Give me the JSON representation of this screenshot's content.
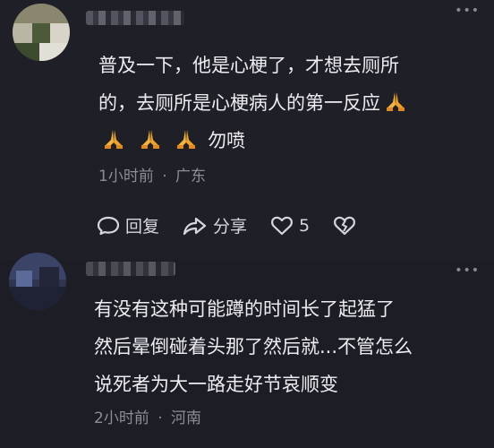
{
  "comments": [
    {
      "text_line1": "普及一下，他是心梗了，才想去厕所",
      "text_line2": "的，去厕所是心梗病人的第一反应",
      "text_line3_suffix": "勿喷",
      "time": "1小时前",
      "location": "广东",
      "actions": {
        "reply_label": "回复",
        "share_label": "分享",
        "like_count": "5"
      }
    },
    {
      "text_line1": "有没有这种可能蹲的时间长了起猛了",
      "text_line2": "然后晕倒碰着头那了然后就...不管怎么",
      "text_line3": "说死者为大一路走好节哀顺变",
      "time": "2小时前",
      "location": "河南"
    }
  ],
  "meta_separator": "·",
  "icons": [
    "more-icon",
    "reply-icon",
    "share-icon",
    "like-icon",
    "dislike-icon",
    "pray-emoji"
  ],
  "colors": {
    "background": "#1f1f27",
    "text": "#ececf1",
    "meta": "#8d8d96",
    "emoji": "#f5b43a"
  }
}
